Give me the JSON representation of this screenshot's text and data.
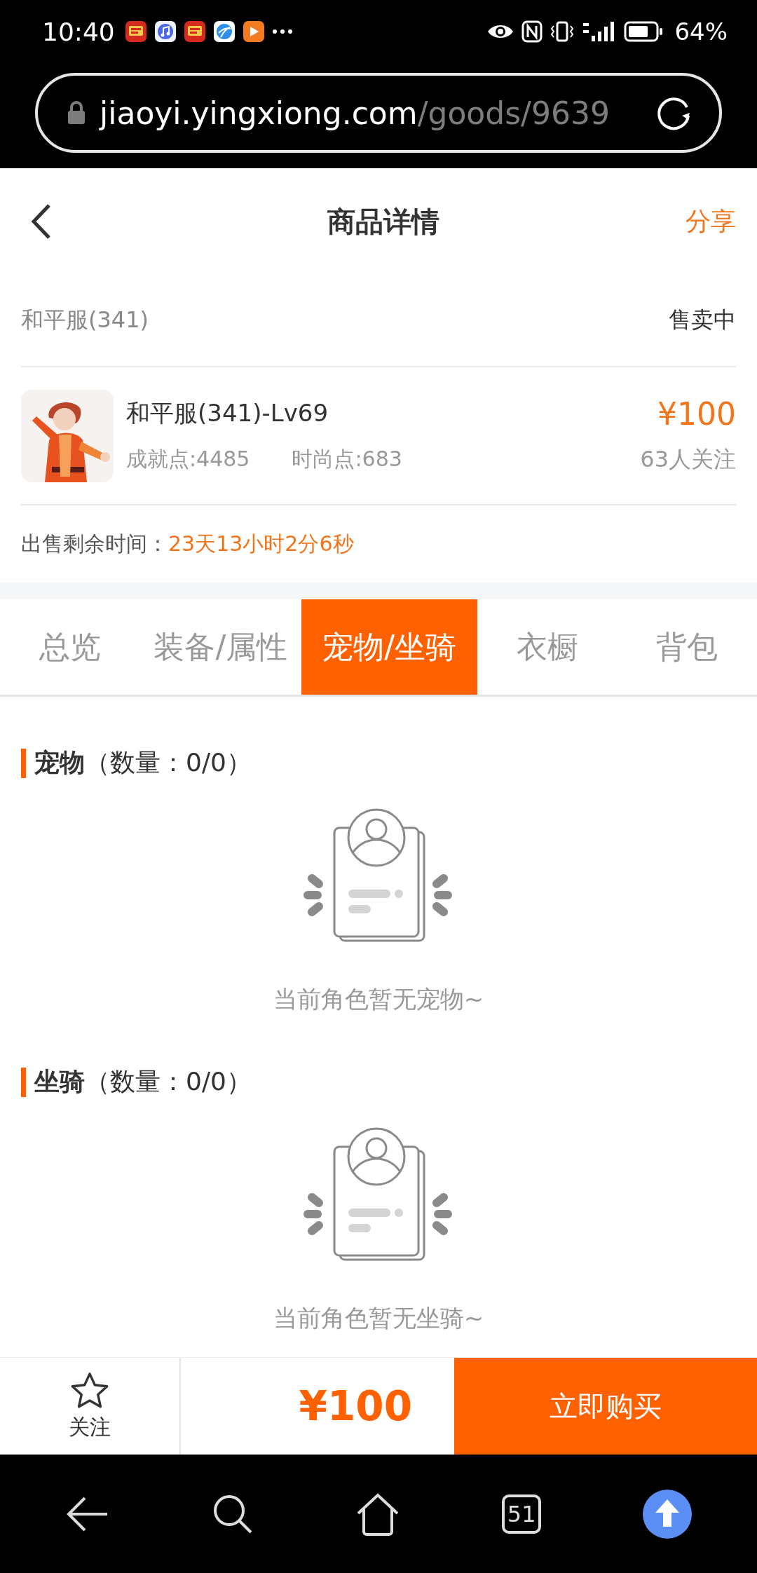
{
  "status_bar": {
    "time": "10:40",
    "battery": "64%"
  },
  "address_bar": {
    "host": "jiaoyi.yingxiong.com",
    "path": "/goods/9639"
  },
  "header": {
    "title": "商品详情",
    "action": "分享"
  },
  "server_row": {
    "server": "和平服(341)",
    "status": "售卖中"
  },
  "goods": {
    "name": "和平服(341)-Lv69",
    "stats": [
      "成就点:4485",
      "时尚点:683"
    ],
    "price": "¥100",
    "followers": "63人关注"
  },
  "remaining": {
    "label": "出售剩余时间：",
    "value": "23天13小时2分6秒"
  },
  "tabs": [
    {
      "label": "总览",
      "selected": false
    },
    {
      "label": "装备/属性",
      "selected": false
    },
    {
      "label": "宠物/坐骑",
      "selected": true
    },
    {
      "label": "衣橱",
      "selected": false
    },
    {
      "label": "背包",
      "selected": false
    }
  ],
  "sections": [
    {
      "heading": "**宠物**（数量：0/0）",
      "empty_text": "当前角色暂无宠物~"
    },
    {
      "heading": "**坐骑**（数量：0/0）",
      "empty_text": "当前角色暂无坐骑~"
    }
  ],
  "buy_bar": {
    "follow": "关注",
    "price": "¥100",
    "buy": "立即购买"
  },
  "nav_bar": {
    "tab_count": "51"
  }
}
